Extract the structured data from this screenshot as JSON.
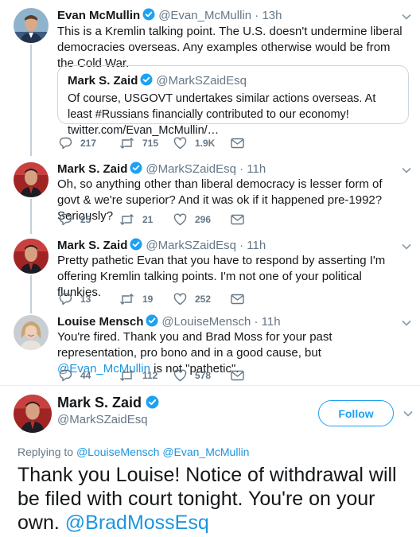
{
  "tweets": [
    {
      "name": "Evan McMullin",
      "handle": "@Evan_McMullin",
      "dot": "·",
      "time": "13h",
      "verified": true,
      "text": "This is a Kremlin talking point. The U.S. doesn't undermine liberal democracies overseas. Any examples otherwise would be from the Cold War.",
      "quote": {
        "name": "Mark S. Zaid",
        "handle": "@MarkSZaidEsq",
        "text": "Of course, USGOVT undertakes similar actions overseas. At least #Russians financially contributed to our economy! twitter.com/Evan_McMullin/…"
      },
      "replies": "217",
      "retweets": "715",
      "likes": "1.9K"
    },
    {
      "name": "Mark S. Zaid",
      "handle": "@MarkSZaidEsq",
      "dot": "·",
      "time": "11h",
      "verified": true,
      "text": "Oh, so anything other than liberal democracy is lesser form of govt & we're superior? And it was ok if it happened pre-1992? Seriously?",
      "replies": "25",
      "retweets": "21",
      "likes": "296"
    },
    {
      "name": "Mark S. Zaid",
      "handle": "@MarkSZaidEsq",
      "dot": "·",
      "time": "11h",
      "verified": true,
      "text": "Pretty pathetic Evan that you have to respond by asserting I'm offering Kremlin talking points. I'm not one of your political flunkies.",
      "replies": "13",
      "retweets": "19",
      "likes": "252"
    },
    {
      "name": "Louise Mensch",
      "handle": "@LouiseMensch",
      "dot": "·",
      "time": "11h",
      "verified": true,
      "text_before": "You're fired. Thank you and Brad Moss for your past representation, pro bono and in a good cause, but ",
      "text_mention": "@Evan_McMullin",
      "text_after": " is not \"pathetic\".",
      "replies": "44",
      "retweets": "112",
      "likes": "578"
    }
  ],
  "main_tweet": {
    "name": "Mark S. Zaid",
    "handle": "@MarkSZaidEsq",
    "follow_label": "Follow",
    "replying_label": "Replying to",
    "replying_to_1": "@LouiseMensch",
    "replying_to_2": "@Evan_McMullin",
    "text": "Thank you Louise! Notice of withdrawal will be filed with court tonight. You're on your own. ",
    "text_mention": "@BradMossEsq"
  },
  "colors": {
    "link": "#1b95e0",
    "verified": "#1da1f2",
    "muted": "#657786"
  }
}
